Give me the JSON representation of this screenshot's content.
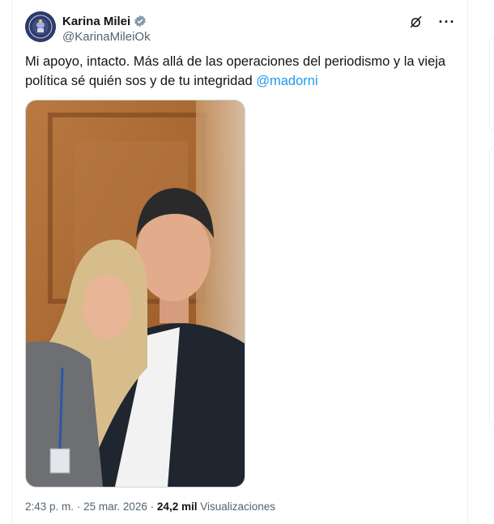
{
  "author": {
    "display_name": "Karina Milei",
    "handle": "@KarinaMileiOk",
    "avatar_icon": "presidential-seal",
    "verified_icon": "verified-badge-gray"
  },
  "tweet": {
    "text_main": "Mi apoyo, intacto. Más allá de las operaciones del periodismo y la vieja política sé quién sos y de tu integridad ",
    "mention": "@madorni"
  },
  "actions": {
    "grok_icon": "grok-icon",
    "more_label": "···"
  },
  "footer": {
    "time": "2:43 p. m.",
    "date": "25 mar. 2026",
    "separator": "·",
    "views_count": "24,2 mil",
    "views_label": "Visualizaciones"
  },
  "colors": {
    "link": "#1d9bf0",
    "secondary_text": "#536471",
    "border": "#cfd9de"
  }
}
